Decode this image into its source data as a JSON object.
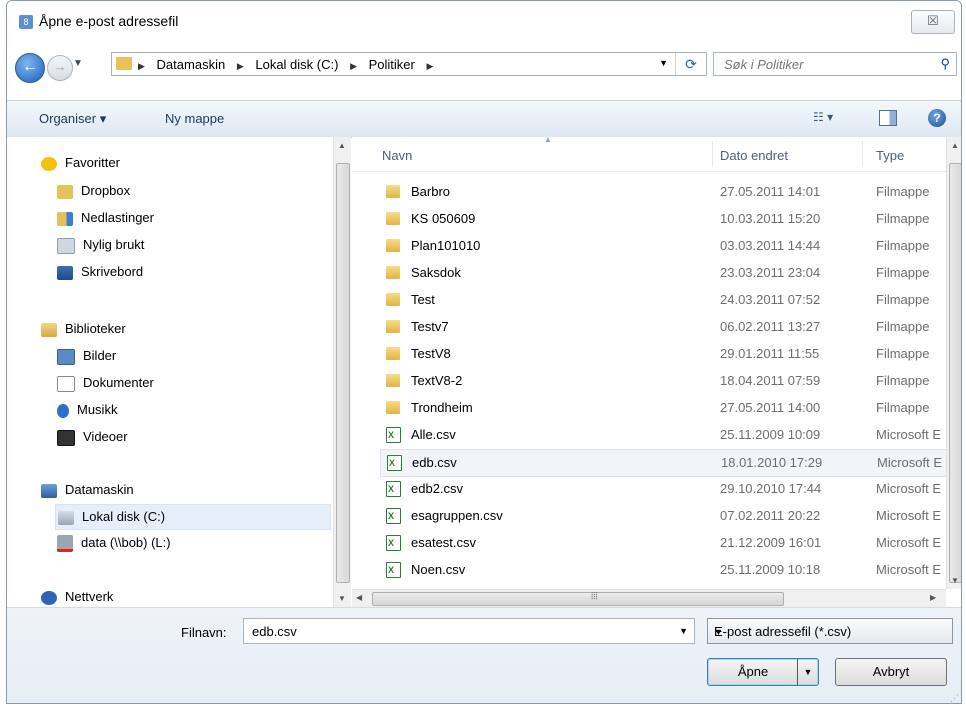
{
  "window": {
    "title": "Åpne e-post adressefil",
    "close_label": "☒"
  },
  "address": {
    "crumbs": [
      "Datamaskin",
      "Lokal disk (C:)",
      "Politiker"
    ]
  },
  "search": {
    "placeholder": "Søk i Politiker"
  },
  "toolbar": {
    "organize_label": "Organiser ▾",
    "new_folder_label": "Ny mappe"
  },
  "nav": {
    "favorites": {
      "label": "Favoritter",
      "items": [
        "Dropbox",
        "Nedlastinger",
        "Nylig brukt",
        "Skrivebord"
      ]
    },
    "libraries": {
      "label": "Biblioteker",
      "items": [
        "Bilder",
        "Dokumenter",
        "Musikk",
        "Videoer"
      ]
    },
    "computer": {
      "label": "Datamaskin",
      "items": [
        "Lokal disk (C:)",
        "data (\\\\bob) (L:)"
      ]
    },
    "network": {
      "label": "Nettverk"
    }
  },
  "files": {
    "columns": {
      "name": "Navn",
      "date": "Dato endret",
      "type": "Type"
    },
    "rows": [
      {
        "name": "Barbro",
        "date": "27.05.2011 14:01",
        "type": "Filmappe",
        "kind": "folder"
      },
      {
        "name": "KS 050609",
        "date": "10.03.2011 15:20",
        "type": "Filmappe",
        "kind": "folder"
      },
      {
        "name": "Plan101010",
        "date": "03.03.2011 14:44",
        "type": "Filmappe",
        "kind": "folder"
      },
      {
        "name": "Saksdok",
        "date": "23.03.2011 23:04",
        "type": "Filmappe",
        "kind": "folder"
      },
      {
        "name": "Test",
        "date": "24.03.2011 07:52",
        "type": "Filmappe",
        "kind": "folder"
      },
      {
        "name": "Testv7",
        "date": "06.02.2011 13:27",
        "type": "Filmappe",
        "kind": "folder"
      },
      {
        "name": "TestV8",
        "date": "29.01.2011 11:55",
        "type": "Filmappe",
        "kind": "folder"
      },
      {
        "name": "TextV8-2",
        "date": "18.04.2011 07:59",
        "type": "Filmappe",
        "kind": "folder"
      },
      {
        "name": "Trondheim",
        "date": "27.05.2011 14:00",
        "type": "Filmappe",
        "kind": "folder"
      },
      {
        "name": "Alle.csv",
        "date": "25.11.2009 10:09",
        "type": "Microsoft E",
        "kind": "csv"
      },
      {
        "name": "edb.csv",
        "date": "18.01.2010 17:29",
        "type": "Microsoft E",
        "kind": "csv"
      },
      {
        "name": "edb2.csv",
        "date": "29.10.2010 17:44",
        "type": "Microsoft E",
        "kind": "csv"
      },
      {
        "name": "esagruppen.csv",
        "date": "07.02.2011 20:22",
        "type": "Microsoft E",
        "kind": "csv"
      },
      {
        "name": "esatest.csv",
        "date": "21.12.2009 16:01",
        "type": "Microsoft E",
        "kind": "csv"
      },
      {
        "name": "Noen.csv",
        "date": "25.11.2009 10:18",
        "type": "Microsoft E",
        "kind": "csv"
      }
    ]
  },
  "bottom": {
    "filename_label": "Filnavn:",
    "filename_value": "edb.csv",
    "filter_value": "E-post adressefil (*.csv)",
    "open_label": "Åpne",
    "cancel_label": "Avbryt"
  }
}
